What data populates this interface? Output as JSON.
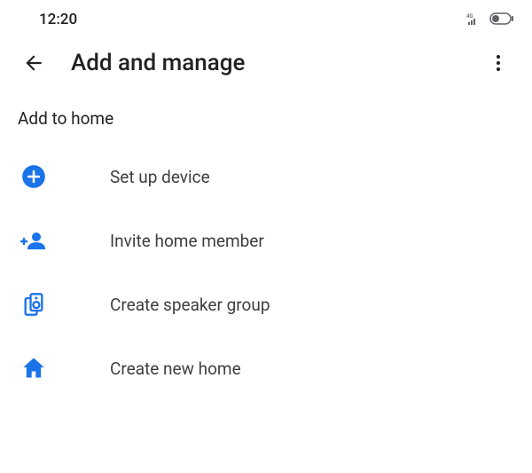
{
  "status_bar": {
    "time": "12:20",
    "network_type": "4G"
  },
  "header": {
    "title": "Add and manage"
  },
  "section": {
    "title": "Add to home"
  },
  "menu": {
    "items": [
      {
        "label": "Set up device",
        "icon": "plus-circle"
      },
      {
        "label": "Invite home member",
        "icon": "person-add"
      },
      {
        "label": "Create speaker group",
        "icon": "speaker-group"
      },
      {
        "label": "Create new home",
        "icon": "home"
      }
    ]
  },
  "colors": {
    "accent": "#1a73e8",
    "text": "#202124"
  }
}
